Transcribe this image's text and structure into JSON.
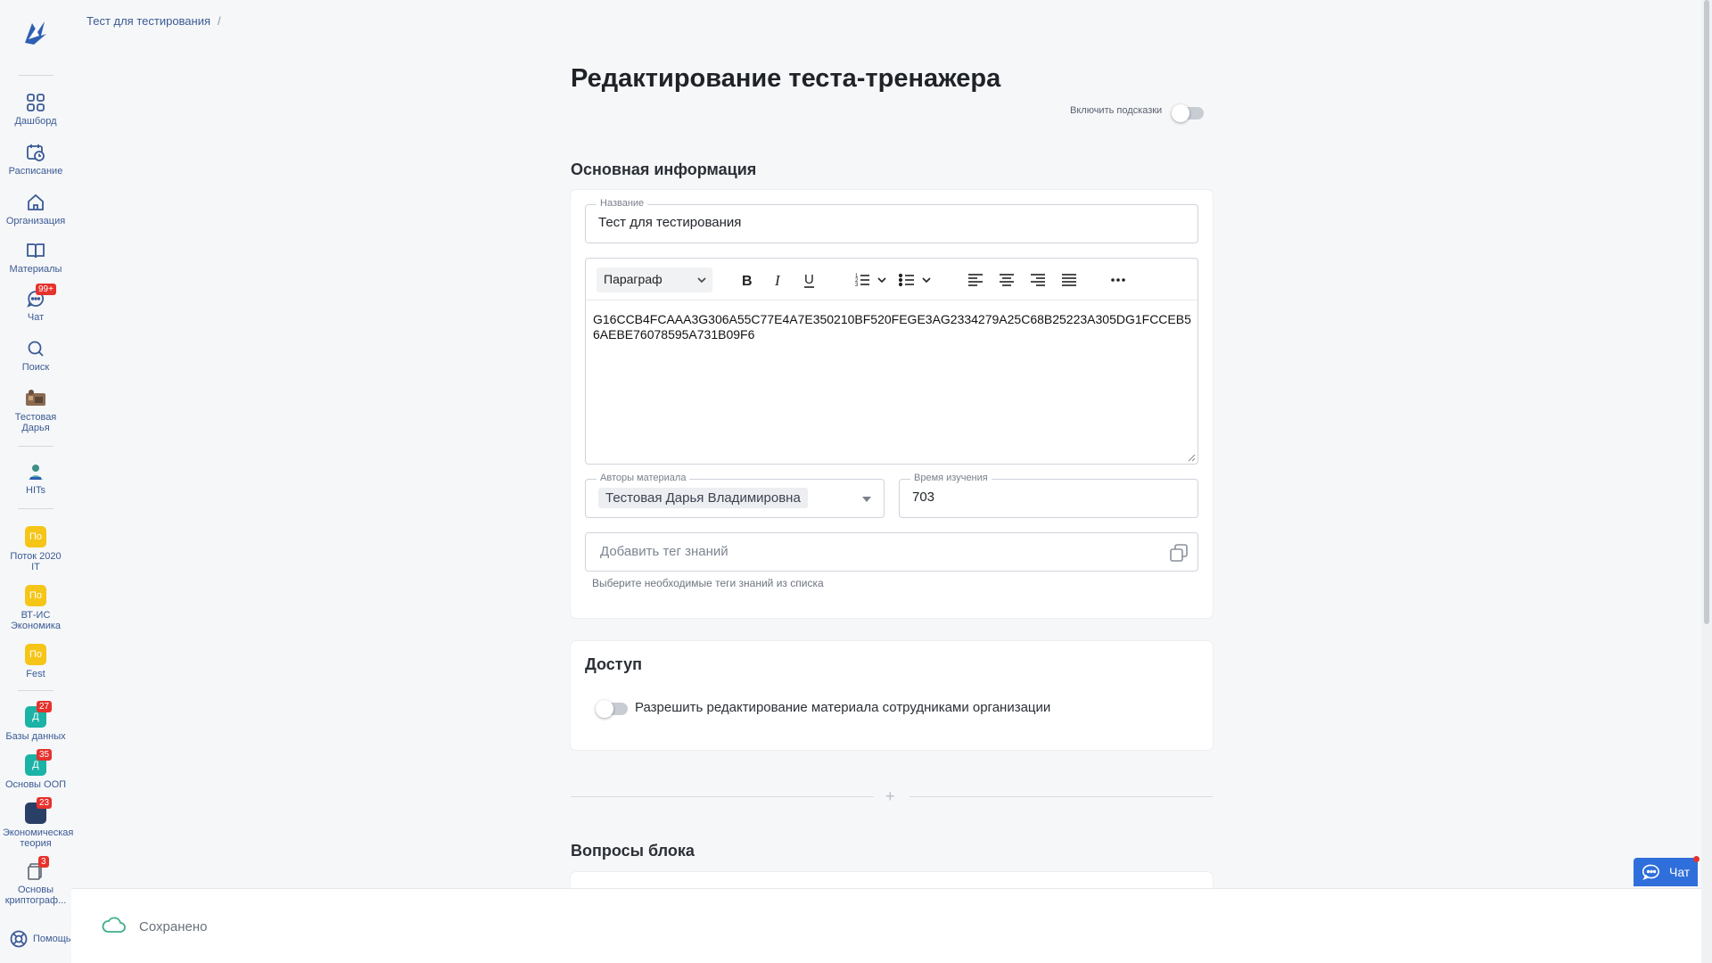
{
  "breadcrumb": {
    "item": "Тест для тестирования",
    "separator": "/"
  },
  "sidebar": {
    "items": [
      {
        "label": "Дашборд",
        "icon": "grid-icon"
      },
      {
        "label": "Расписание",
        "icon": "calendar-clock-icon"
      },
      {
        "label": "Организация",
        "icon": "home-icon"
      },
      {
        "label": "Материалы",
        "icon": "book-icon"
      },
      {
        "label": "Чат",
        "icon": "chat-icon",
        "badge": "99+"
      },
      {
        "label": "Поиск",
        "icon": "search-icon"
      },
      {
        "label": "Тестовая Дарья",
        "icon": "avatar-image"
      },
      {
        "label": "HITs",
        "icon": "avatar-image"
      },
      {
        "label": "Поток 2020 IT",
        "initials": "По"
      },
      {
        "label": "ВТ-ИС Экономика",
        "initials": "По"
      },
      {
        "label": "Fest",
        "initials": "По"
      },
      {
        "label": "Базы данных",
        "initials": "Д",
        "badge": "27"
      },
      {
        "label": "Основы ООП",
        "initials": "Д",
        "badge": "35"
      },
      {
        "label": "Экономическая теория",
        "badge": "23"
      },
      {
        "label": "Основы криптограф...",
        "badge": "3"
      }
    ],
    "help": "Помощь"
  },
  "page": {
    "title": "Редактирование теста-тренажера",
    "hints_label": "Включить подсказки"
  },
  "main_info": {
    "title": "Основная информация",
    "name_label": "Название",
    "name_value": "Тест для тестирования",
    "editor_paragraph": "Параграф",
    "editor_text": "G16CCB4FCAAA3G306A55C77E4A7E350210BF520FEGE3AG2334279A25C68B25223A305DG1FCCEB56AEBE76078595A731B09F6",
    "authors_label": "Авторы материала",
    "author_chip": "Тестовая Дарья Владимировна",
    "time_label": "Время изучения",
    "time_value": "703",
    "tag_placeholder": "Добавить тег знаний",
    "tag_helper": "Выберите необходимые теги знаний из списка"
  },
  "access": {
    "title": "Доступ",
    "toggle_label": "Разрешить редактирование материала сотрудниками организации"
  },
  "divider": {
    "symbol": "+"
  },
  "questions": {
    "title": "Вопросы блока"
  },
  "savebar": {
    "status": "Сохранено"
  },
  "chat_widget": {
    "label": "Чат"
  },
  "colors": {
    "accent": "#2f6fdb",
    "nav_text": "#3a5a94",
    "badge": "#e5322d",
    "yellow": "#f5c518",
    "teal": "#1ab3a6"
  }
}
